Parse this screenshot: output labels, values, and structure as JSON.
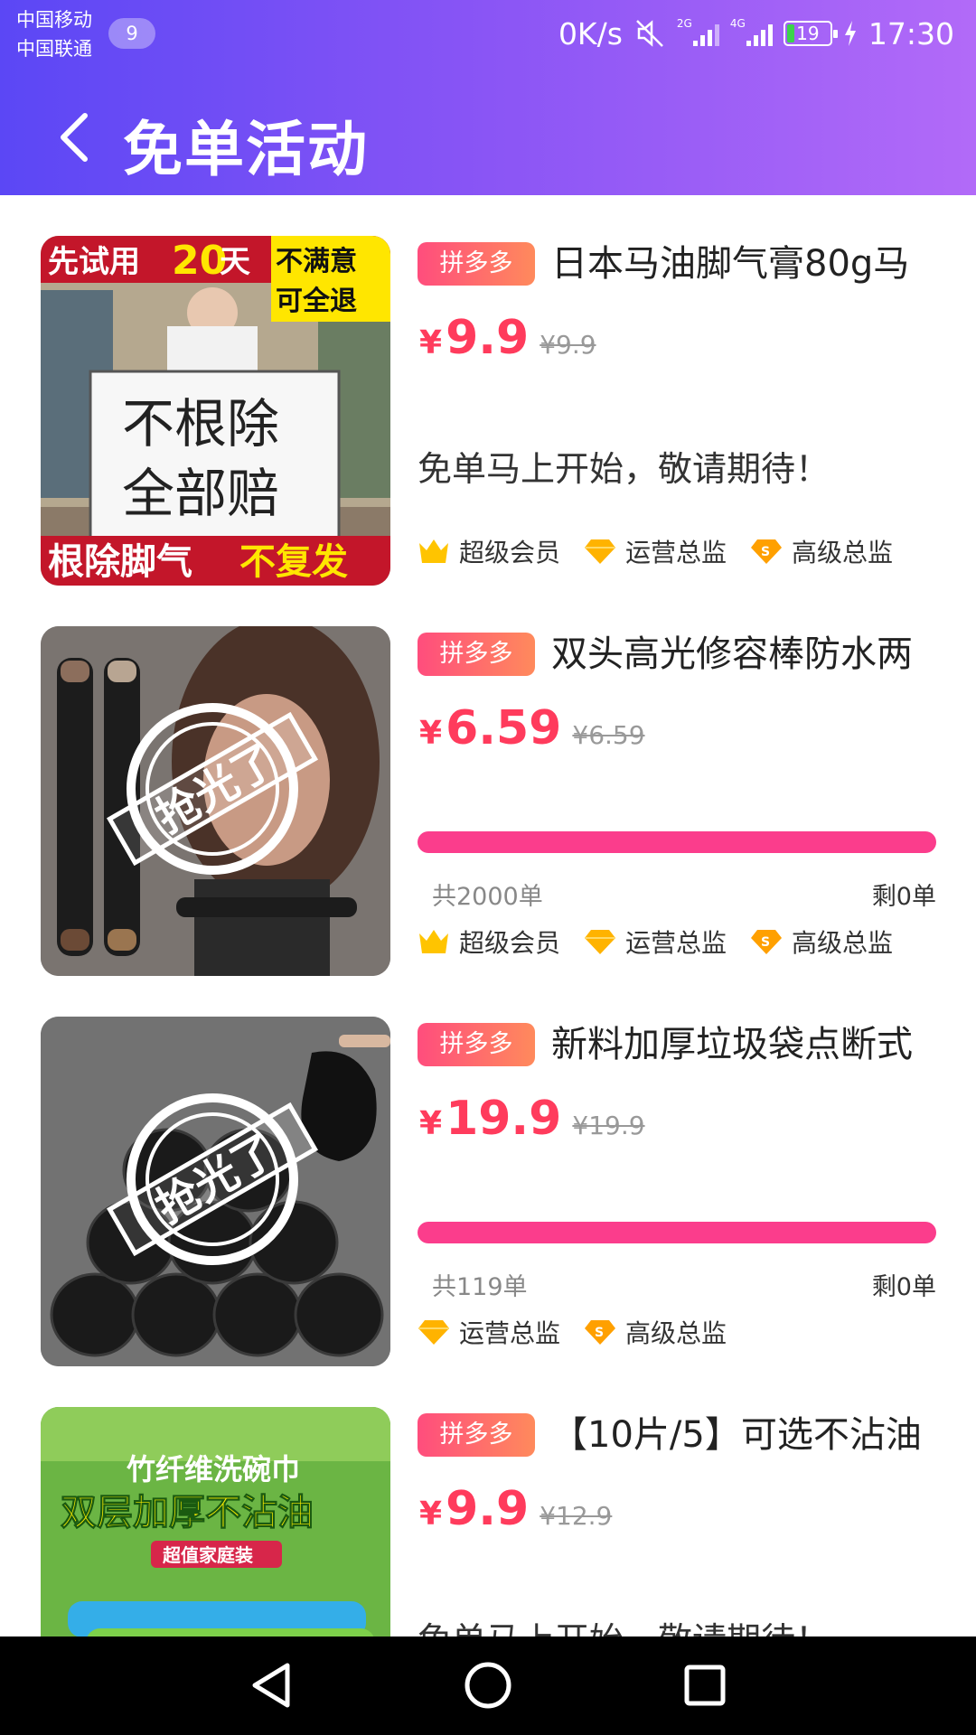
{
  "status_bar": {
    "carrier1": "中国移动",
    "carrier2": "中国联通",
    "badge": "9",
    "speed": "0K/s",
    "net1": "2G",
    "net2": "4G",
    "battery": "19",
    "time": "17:30"
  },
  "nav": {
    "title": "免单活动"
  },
  "colors": {
    "header_gradient_start": "#5b47f5",
    "header_gradient_end": "#b26af8",
    "price_red": "#ff3b5c",
    "progress_pink": "#fb3d8c",
    "tag_gradient_start": "#ff4d7d",
    "tag_gradient_end": "#ff8a5c"
  },
  "products": [
    {
      "tag": "拼多多",
      "title": "日本马油脚气膏80g马",
      "yen": "¥",
      "price": "9.9",
      "original": "¥9.9",
      "notice": "免单马上开始，敬请期待！",
      "levels": [
        {
          "label": "超级会员",
          "icon": "crown-icon"
        },
        {
          "label": "运营总监",
          "icon": "diamond-icon"
        },
        {
          "label": "高级总监",
          "icon": "s-diamond-icon"
        }
      ],
      "image": {
        "top_left": "先试用",
        "top_num": "20",
        "top_day": "天",
        "top_right1": "不满意",
        "top_right2": "可全退",
        "board1": "不根除",
        "board2": "全部赔",
        "bottom1": "根除脚气",
        "bottom2": "不复发"
      }
    },
    {
      "tag": "拼多多",
      "title": "双头高光修容棒防水两",
      "yen": "¥",
      "price": "6.59",
      "original": "¥6.59",
      "progress": 1.0,
      "total": "共2000单",
      "remain": "剩0单",
      "watermark": "抢光了",
      "levels": [
        {
          "label": "超级会员",
          "icon": "crown-icon"
        },
        {
          "label": "运营总监",
          "icon": "diamond-icon"
        },
        {
          "label": "高级总监",
          "icon": "s-diamond-icon"
        }
      ]
    },
    {
      "tag": "拼多多",
      "title": "新料加厚垃圾袋点断式",
      "yen": "¥",
      "price": "19.9",
      "original": "¥19.9",
      "progress": 1.0,
      "total": "共119单",
      "remain": "剩0单",
      "watermark": "抢光了",
      "levels": [
        {
          "label": "运营总监",
          "icon": "diamond-icon"
        },
        {
          "label": "高级总监",
          "icon": "s-diamond-icon"
        }
      ]
    },
    {
      "tag": "拼多多",
      "title": "【10片/5】可选不沾油",
      "yen": "¥",
      "price": "9.9",
      "original": "¥12.9",
      "notice": "免单马上开始，敬请期待！",
      "image": {
        "line1": "竹纤维洗碗巾",
        "line2": "双层加厚不沾油",
        "line3": "超值家庭装"
      }
    }
  ]
}
